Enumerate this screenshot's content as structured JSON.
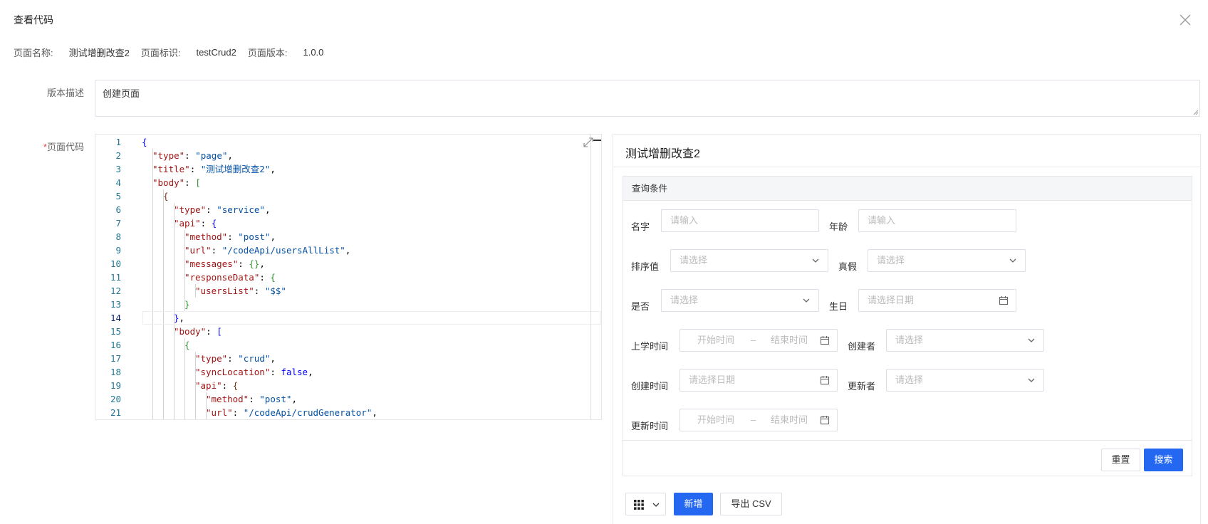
{
  "dialog": {
    "title": "查看代码"
  },
  "meta": {
    "name_label": "页面名称:",
    "name_value": "测试增删改查2",
    "id_label": "页面标识:",
    "id_value": "testCrud2",
    "version_label": "页面版本:",
    "version_value": "1.0.0"
  },
  "form": {
    "desc_label": "版本描述",
    "desc_value": "创建页面",
    "code_required_mark": "*",
    "code_label": "页面代码"
  },
  "editor": {
    "active_line": 14,
    "line_numbers": [
      "1",
      "2",
      "3",
      "4",
      "5",
      "6",
      "7",
      "8",
      "9",
      "10",
      "11",
      "12",
      "13",
      "14",
      "15",
      "16",
      "17",
      "18",
      "19",
      "20",
      "21"
    ]
  },
  "preview": {
    "title": "测试增删改查2",
    "query_title": "查询条件",
    "fields": {
      "name_label": "名字",
      "name_placeholder": "请输入",
      "age_label": "年龄",
      "age_placeholder": "请输入",
      "sort_label": "排序值",
      "sort_placeholder": "请选择",
      "truth_label": "真假",
      "truth_placeholder": "请选择",
      "yesno_label": "是否",
      "yesno_placeholder": "请选择",
      "birthday_label": "生日",
      "birthday_placeholder": "请选择日期",
      "school_label": "上学时间",
      "school_start": "开始时间",
      "school_end": "结束时间",
      "creator_label": "创建者",
      "creator_placeholder": "请选择",
      "created_label": "创建时间",
      "created_placeholder": "请选择日期",
      "updater_label": "更新者",
      "updater_placeholder": "请选择",
      "updated_label": "更新时间",
      "updated_start": "开始时间",
      "updated_end": "结束时间",
      "range_sep": "–"
    },
    "reset_label": "重置",
    "search_label": "搜索",
    "add_label": "新增",
    "export_label": "导出 CSV"
  },
  "colors": {
    "primary": "#2468f2",
    "border": "#dcdfe6"
  }
}
